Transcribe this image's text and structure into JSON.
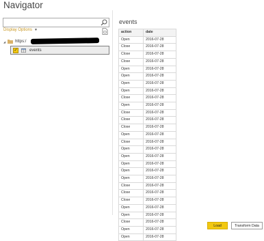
{
  "window": {
    "title": "Navigator"
  },
  "search": {
    "value": "",
    "placeholder": ""
  },
  "display_options": {
    "label": "Display Options"
  },
  "tree": {
    "root": {
      "label": "https:/"
    },
    "items": [
      {
        "label": "events",
        "checked": true
      }
    ]
  },
  "preview": {
    "title": "events",
    "columns": [
      "action",
      "date"
    ],
    "rows": [
      [
        "Open",
        "2016-07-28"
      ],
      [
        "Close",
        "2016-07-28"
      ],
      [
        "Close",
        "2016-07-28"
      ],
      [
        "Close",
        "2016-07-28"
      ],
      [
        "Open",
        "2016-07-28"
      ],
      [
        "Open",
        "2016-07-28"
      ],
      [
        "Open",
        "2016-07-28"
      ],
      [
        "Open",
        "2016-07-28"
      ],
      [
        "Close",
        "2016-07-28"
      ],
      [
        "Open",
        "2016-07-28"
      ],
      [
        "Close",
        "2016-07-28"
      ],
      [
        "Close",
        "2016-07-28"
      ],
      [
        "Close",
        "2016-07-28"
      ],
      [
        "Open",
        "2016-07-28"
      ],
      [
        "Close",
        "2016-07-28"
      ],
      [
        "Open",
        "2016-07-28"
      ],
      [
        "Open",
        "2016-07-28"
      ],
      [
        "Open",
        "2016-07-28"
      ],
      [
        "Open",
        "2016-07-28"
      ],
      [
        "Open",
        "2016-07-28"
      ],
      [
        "Close",
        "2016-07-28"
      ],
      [
        "Close",
        "2016-07-28"
      ],
      [
        "Close",
        "2016-07-28"
      ],
      [
        "Open",
        "2016-07-28"
      ],
      [
        "Open",
        "2016-07-28"
      ],
      [
        "Close",
        "2016-07-28"
      ],
      [
        "Open",
        "2016-07-28"
      ],
      [
        "Open",
        "2016-07-28"
      ]
    ]
  },
  "buttons": {
    "load": "Load",
    "transform": "Transform Data"
  },
  "colors": {
    "accent": "#f2c811",
    "link": "#c8961f"
  }
}
